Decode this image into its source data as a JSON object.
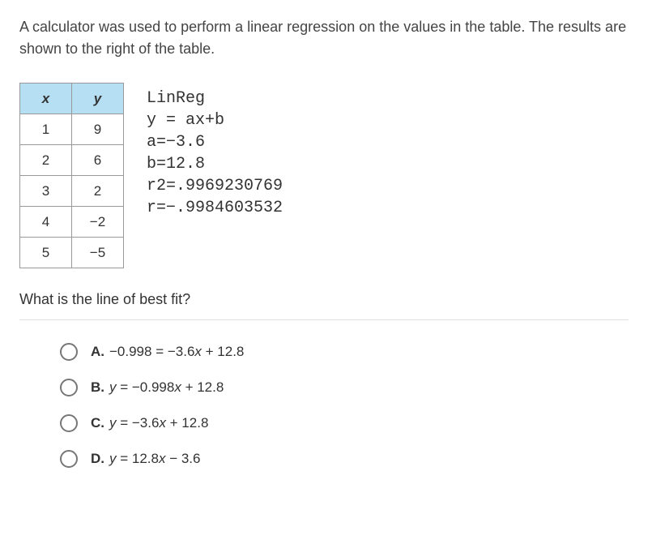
{
  "prompt": "A calculator was used to perform a linear regression on the values in the table. The results are shown to the right of the table.",
  "table": {
    "head_x": "x",
    "head_y": "y",
    "rows": [
      {
        "x": "1",
        "y": "9"
      },
      {
        "x": "2",
        "y": "6"
      },
      {
        "x": "3",
        "y": "2"
      },
      {
        "x": "4",
        "y": "−2"
      },
      {
        "x": "5",
        "y": "−5"
      }
    ]
  },
  "linreg": {
    "l1": "LinReg",
    "l2": "y = ax+b",
    "l3": "a=−3.6",
    "l4": "b=12.8",
    "l5": "r2=.9969230769",
    "l6": "r=−.9984603532"
  },
  "subquestion": "What is the line of best fit?",
  "options": {
    "A": {
      "letter": "A.",
      "pre": "−0.998 = −3.6",
      "xvar": "x",
      "post": " + 12.8"
    },
    "B": {
      "letter": "B.",
      "yvar": "y",
      "eq": " = −0.998",
      "xvar": "x",
      "post": " + 12.8"
    },
    "C": {
      "letter": "C.",
      "yvar": "y",
      "eq": " = −3.6",
      "xvar": "x",
      "post": " + 12.8"
    },
    "D": {
      "letter": "D.",
      "yvar": "y",
      "eq": " = 12.8",
      "xvar": "x",
      "post": " − 3.6"
    }
  },
  "chart_data": {
    "type": "table",
    "columns": [
      "x",
      "y"
    ],
    "rows": [
      [
        1,
        9
      ],
      [
        2,
        6
      ],
      [
        3,
        2
      ],
      [
        4,
        -2
      ],
      [
        5,
        -5
      ]
    ],
    "regression": {
      "model": "y = ax+b",
      "a": -3.6,
      "b": 12.8,
      "r2": 0.9969230769,
      "r": -0.9984603532
    }
  }
}
